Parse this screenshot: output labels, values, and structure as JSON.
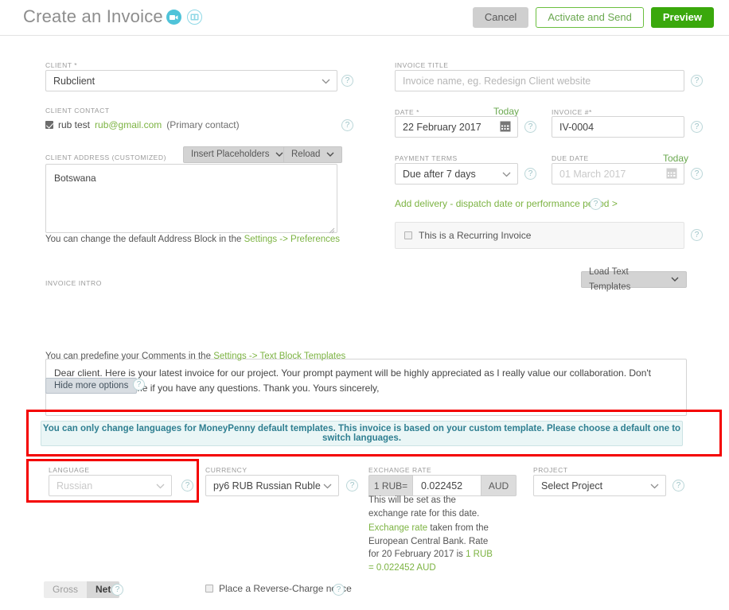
{
  "header": {
    "title": "Create an Invoice",
    "icons": [
      {
        "name": "video-icon",
        "kind": "filled"
      },
      {
        "name": "guide-book-icon",
        "kind": "outline"
      }
    ],
    "buttons": {
      "cancel": "Cancel",
      "activate": "Activate and Send",
      "preview": "Preview"
    }
  },
  "left": {
    "client": {
      "label": "CLIENT *",
      "value": "Rubclient"
    },
    "client_contact": {
      "label": "CLIENT CONTACT",
      "checked": true,
      "name": "rub test",
      "email": "rub@gmail.com",
      "suffix": "(Primary contact)"
    },
    "address": {
      "label": "CLIENT ADDRESS (CUSTOMIZED)",
      "value": "Botswana",
      "insert_placeholders": "Insert Placeholders",
      "reload": "Reload",
      "hint_before": "You can change the default Address Block in the ",
      "hint_link": "Settings -> Preferences"
    }
  },
  "right": {
    "invoice_title": {
      "label": "INVOICE TITLE",
      "placeholder": "Invoice name, eg. Redesign Client website",
      "value": ""
    },
    "date": {
      "label": "DATE *",
      "today": "Today",
      "value": "22 February 2017"
    },
    "invoice_number": {
      "label": "INVOICE #*",
      "value": "IV-0004"
    },
    "payment_terms": {
      "label": "PAYMENT TERMS",
      "value": "Due after 7 days"
    },
    "due_date": {
      "label": "DUE DATE",
      "today": "Today",
      "value": "01 March 2017"
    },
    "delivery_link": "Add delivery - dispatch date or performance period >",
    "recurring": {
      "label": "This is a Recurring Invoice",
      "checked": false
    }
  },
  "intro": {
    "label": "INVOICE INTRO",
    "load_templates": "Load Text Templates",
    "value": "Dear client. Here is your latest invoice for our project. Your prompt payment will be highly appreciated as I really value our collaboration. Don't hesitate to contact me if you have any questions. Thank you. Yours sincerely,",
    "hint_before": "You can predefine your Comments in the ",
    "hint_link": "Settings -> Text Block Templates"
  },
  "more_options": {
    "toggle_label": "Hide more options"
  },
  "notice": {
    "text": "You can only change languages for MoneyPenny default templates. This invoice is based on your custom template. Please choose a default one to switch languages."
  },
  "options_row": {
    "language": {
      "label": "LANGUAGE",
      "value": "Russian",
      "disabled": true
    },
    "currency": {
      "label": "CURRENCY",
      "value": "py6 RUB Russian Ruble"
    },
    "exchange_rate": {
      "label": "EXCHANGE RATE",
      "prefix": "1 RUB=",
      "value": "0.022452",
      "suffix": "AUD",
      "note": "This will be set as the exchange rate for this date.",
      "source_link": "Exchange rate",
      "source_text_1": " taken from the European Central Bank. Rate for 20 February 2017 is ",
      "source_rate": "1 RUB = 0.022452 AUD"
    },
    "project": {
      "label": "PROJECT",
      "value": "Select Project"
    }
  },
  "footer": {
    "gross": "Gross",
    "net": "Net",
    "reverse_charge": "Place a Reverse-Charge notice",
    "reverse_charge_checked": false
  },
  "colors": {
    "accent_teal": "#4fc3d9",
    "green_primary": "#3aa80c",
    "green_link": "#7cb342",
    "notice_text": "#2f7f91",
    "highlight_red": "#f40000"
  }
}
